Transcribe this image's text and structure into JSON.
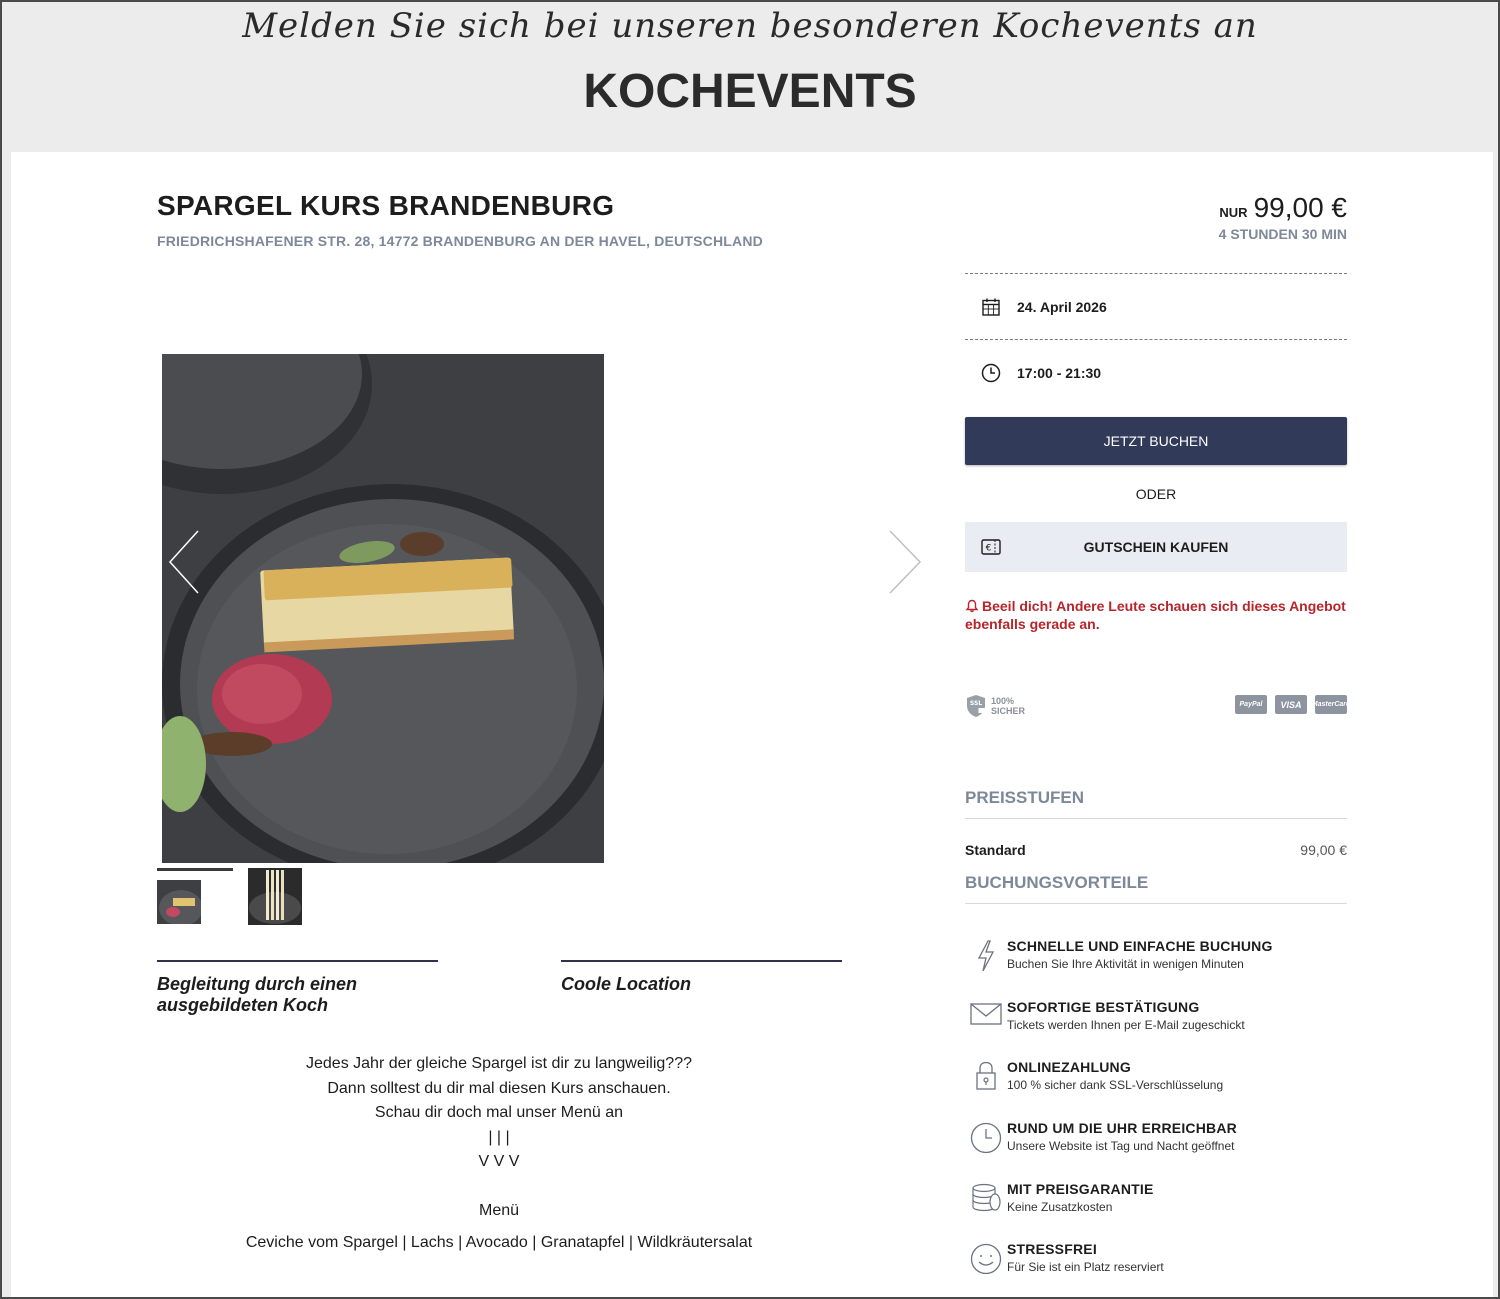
{
  "header": {
    "tagline": "Melden Sie sich bei unseren besonderen Kochevents an",
    "title": "KOCHEVENTS"
  },
  "event": {
    "title": "SPARGEL KURS BRANDENBURG",
    "address": "FRIEDRICHSHAFENER STR. 28, 14772 BRANDENBURG AN DER HAVEL, DEUTSCHLAND",
    "price_prefix": "NUR",
    "price": "99,00 €",
    "duration": "4 STUNDEN 30 MIN",
    "date": "24. April 2026",
    "time": "17:00 - 21:30"
  },
  "gallery": {
    "main_image": "dessert-plate-photo",
    "thumbnails": [
      "dessert-plate-thumb",
      "asparagus-thumb"
    ]
  },
  "features": [
    {
      "label": "Begleitung durch einen ausgebildeten Koch"
    },
    {
      "label": "Coole Location"
    }
  ],
  "description": {
    "lines": [
      "Jedes Jahr der gleiche Spargel ist dir zu langweilig???",
      "Dann solltest du dir mal diesen Kurs anschauen.",
      "Schau dir doch mal unser Menü an",
      "| | |",
      "V V V"
    ],
    "menu_heading": "Menü",
    "menu_item": "Ceviche vom Spargel | Lachs | Avocado | Granatapfel | Wildkräutersalat"
  },
  "actions": {
    "book": "JETZT BUCHEN",
    "or": "ODER",
    "voucher": "GUTSCHEIN KAUFEN"
  },
  "alert": "Beeil dich! Andere Leute schauen sich dieses Angebot ebenfalls gerade an.",
  "trust": {
    "ssl_line1": "100%",
    "ssl_line2": "SICHER",
    "ssl_shield": "SSL",
    "payments": [
      "PayPal",
      "VISA",
      "MasterCard"
    ]
  },
  "pricing": {
    "title": "PREISSTUFEN",
    "tiers": [
      {
        "name": "Standard",
        "price": "99,00 €"
      }
    ]
  },
  "benefits": {
    "title": "BUCHUNGSVORTEILE",
    "items": [
      {
        "icon": "lightning-icon",
        "title": "SCHNELLE UND EINFACHE BUCHUNG",
        "subtitle": "Buchen Sie Ihre Aktivität in wenigen Minuten"
      },
      {
        "icon": "envelope-icon",
        "title": "SOFORTIGE BESTÄTIGUNG",
        "subtitle": "Tickets werden Ihnen per E-Mail zugeschickt"
      },
      {
        "icon": "lock-icon",
        "title": "ONLINEZAHLUNG",
        "subtitle": "100 % sicher dank SSL-Verschlüsselung"
      },
      {
        "icon": "clock-icon",
        "title": "RUND UM DIE UHR ERREICHBAR",
        "subtitle": "Unsere Website ist Tag und Nacht geöffnet"
      },
      {
        "icon": "coins-icon",
        "title": "MIT PREISGARANTIE",
        "subtitle": "Keine Zusatzkosten"
      },
      {
        "icon": "smiley-icon",
        "title": "STRESSFREI",
        "subtitle": "Für Sie ist ein Platz reserviert"
      }
    ]
  },
  "colors": {
    "primary_button": "#313a59",
    "alert": "#b5252b",
    "muted_heading": "#7d8899",
    "voucher_bg": "#e9ecf3"
  }
}
